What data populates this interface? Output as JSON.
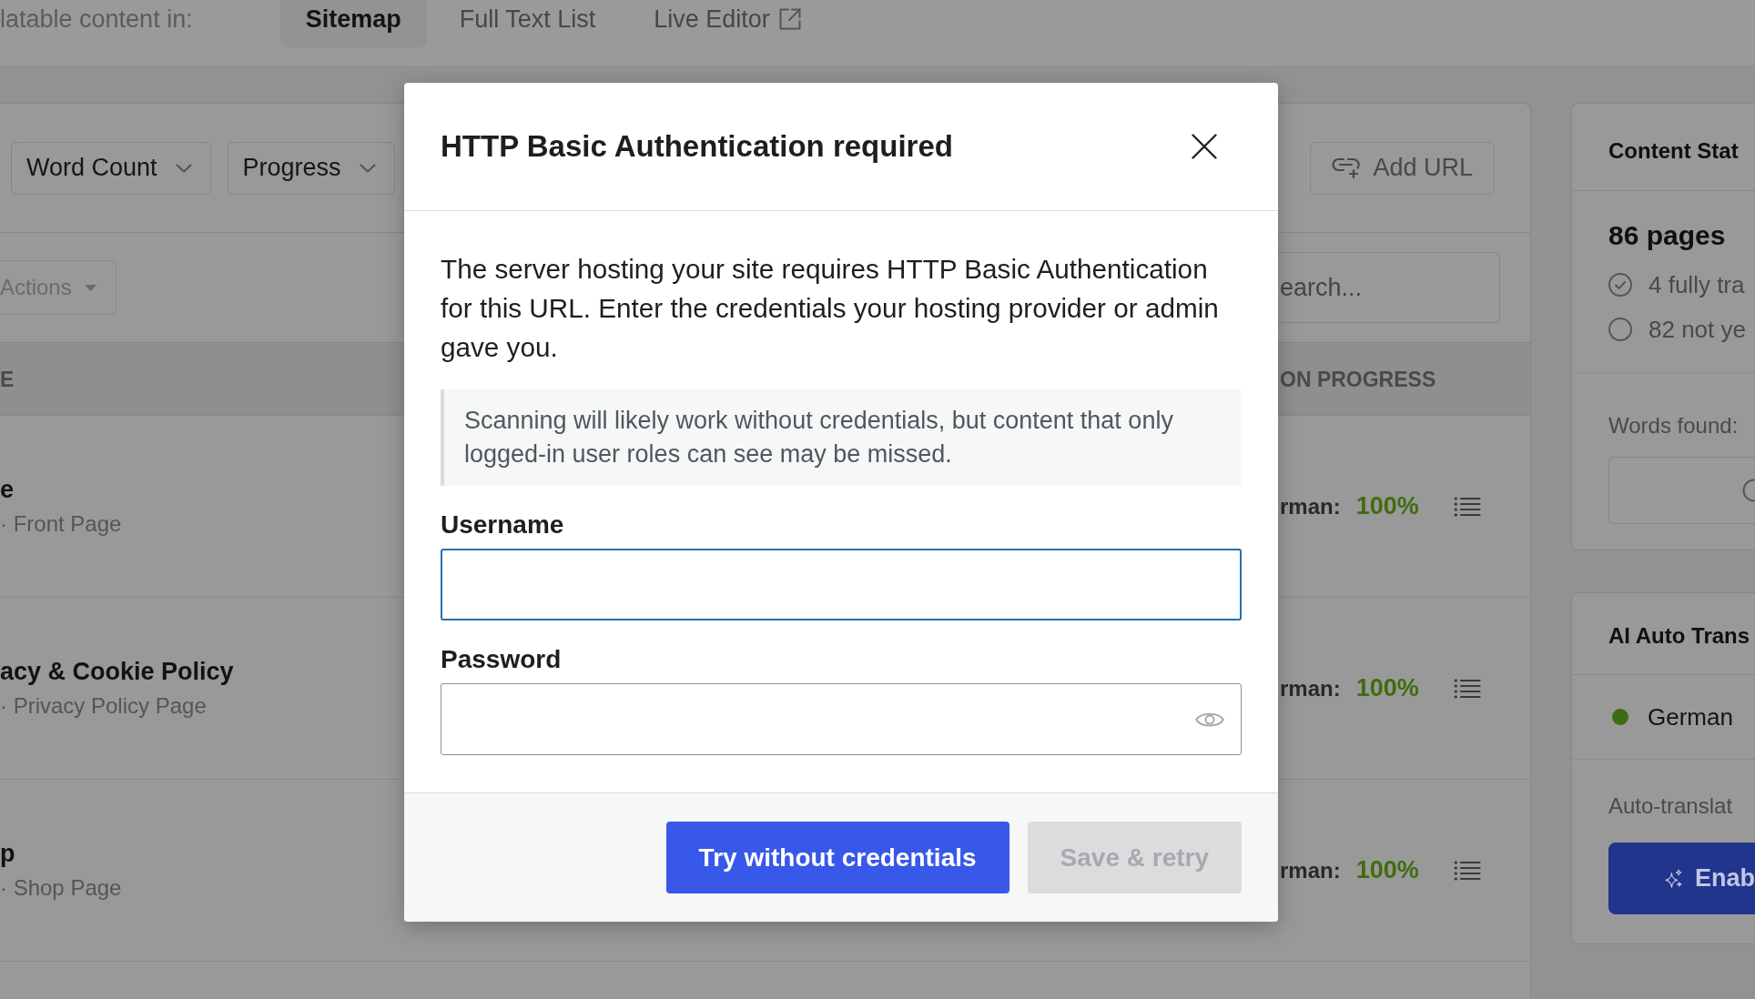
{
  "top_bar": {
    "label": "latable content in:",
    "tabs": [
      {
        "label": "Sitemap",
        "selected": true,
        "external": false
      },
      {
        "label": "Full Text List",
        "selected": false,
        "external": false
      },
      {
        "label": "Live Editor",
        "selected": false,
        "external": true
      }
    ]
  },
  "content_panel": {
    "filters": [
      {
        "label": "Word Count"
      },
      {
        "label": "Progress"
      }
    ],
    "add_url_button": {
      "label": "Add URL"
    },
    "bulk_actions": {
      "label": "Actions",
      "disabled": true
    },
    "search": {
      "placeholder": "earch..."
    },
    "table": {
      "columns": [
        {
          "label": "E"
        },
        {
          "label": "ON PROGRESS"
        }
      ],
      "rows": [
        {
          "title": "e",
          "subtitle": "· Front Page",
          "language": "rman:",
          "progress": "100%"
        },
        {
          "title": "acy & Cookie Policy",
          "subtitle": "· Privacy Policy Page",
          "language": "rman:",
          "progress": "100%"
        },
        {
          "title": "p",
          "subtitle": "· Shop Page",
          "language": "rman:",
          "progress": "100%"
        }
      ]
    }
  },
  "sidebar": {
    "stats_card": {
      "title": "Content Stat",
      "total": "86 pages",
      "items": [
        {
          "kind": "done",
          "text": "4 fully tra"
        },
        {
          "kind": "pending",
          "text": "82 not ye"
        }
      ],
      "words_label": "Words found:"
    },
    "auto_translate_card": {
      "title": "AI Auto Trans",
      "languages": [
        {
          "name": "German",
          "color": "#3f6b12"
        }
      ],
      "caption": "Auto-translat",
      "button": {
        "label": "Enab"
      }
    }
  },
  "dialog": {
    "title": "HTTP Basic Authentication required",
    "message": "The server hosting your site requires HTTP Basic Authentication for this URL. Enter the credentials your hosting provider or admin gave you.",
    "note": "Scanning will likely work without credentials, but content that only logged-in user roles can see may be missed.",
    "fields": [
      {
        "label": "Username",
        "kind": "text",
        "focused": true
      },
      {
        "label": "Password",
        "kind": "password",
        "focused": false
      }
    ],
    "buttons": [
      {
        "label": "Try without credentials",
        "kind": "primary",
        "disabled": false
      },
      {
        "label": "Save & retry",
        "kind": "secondary",
        "disabled": true
      }
    ]
  }
}
